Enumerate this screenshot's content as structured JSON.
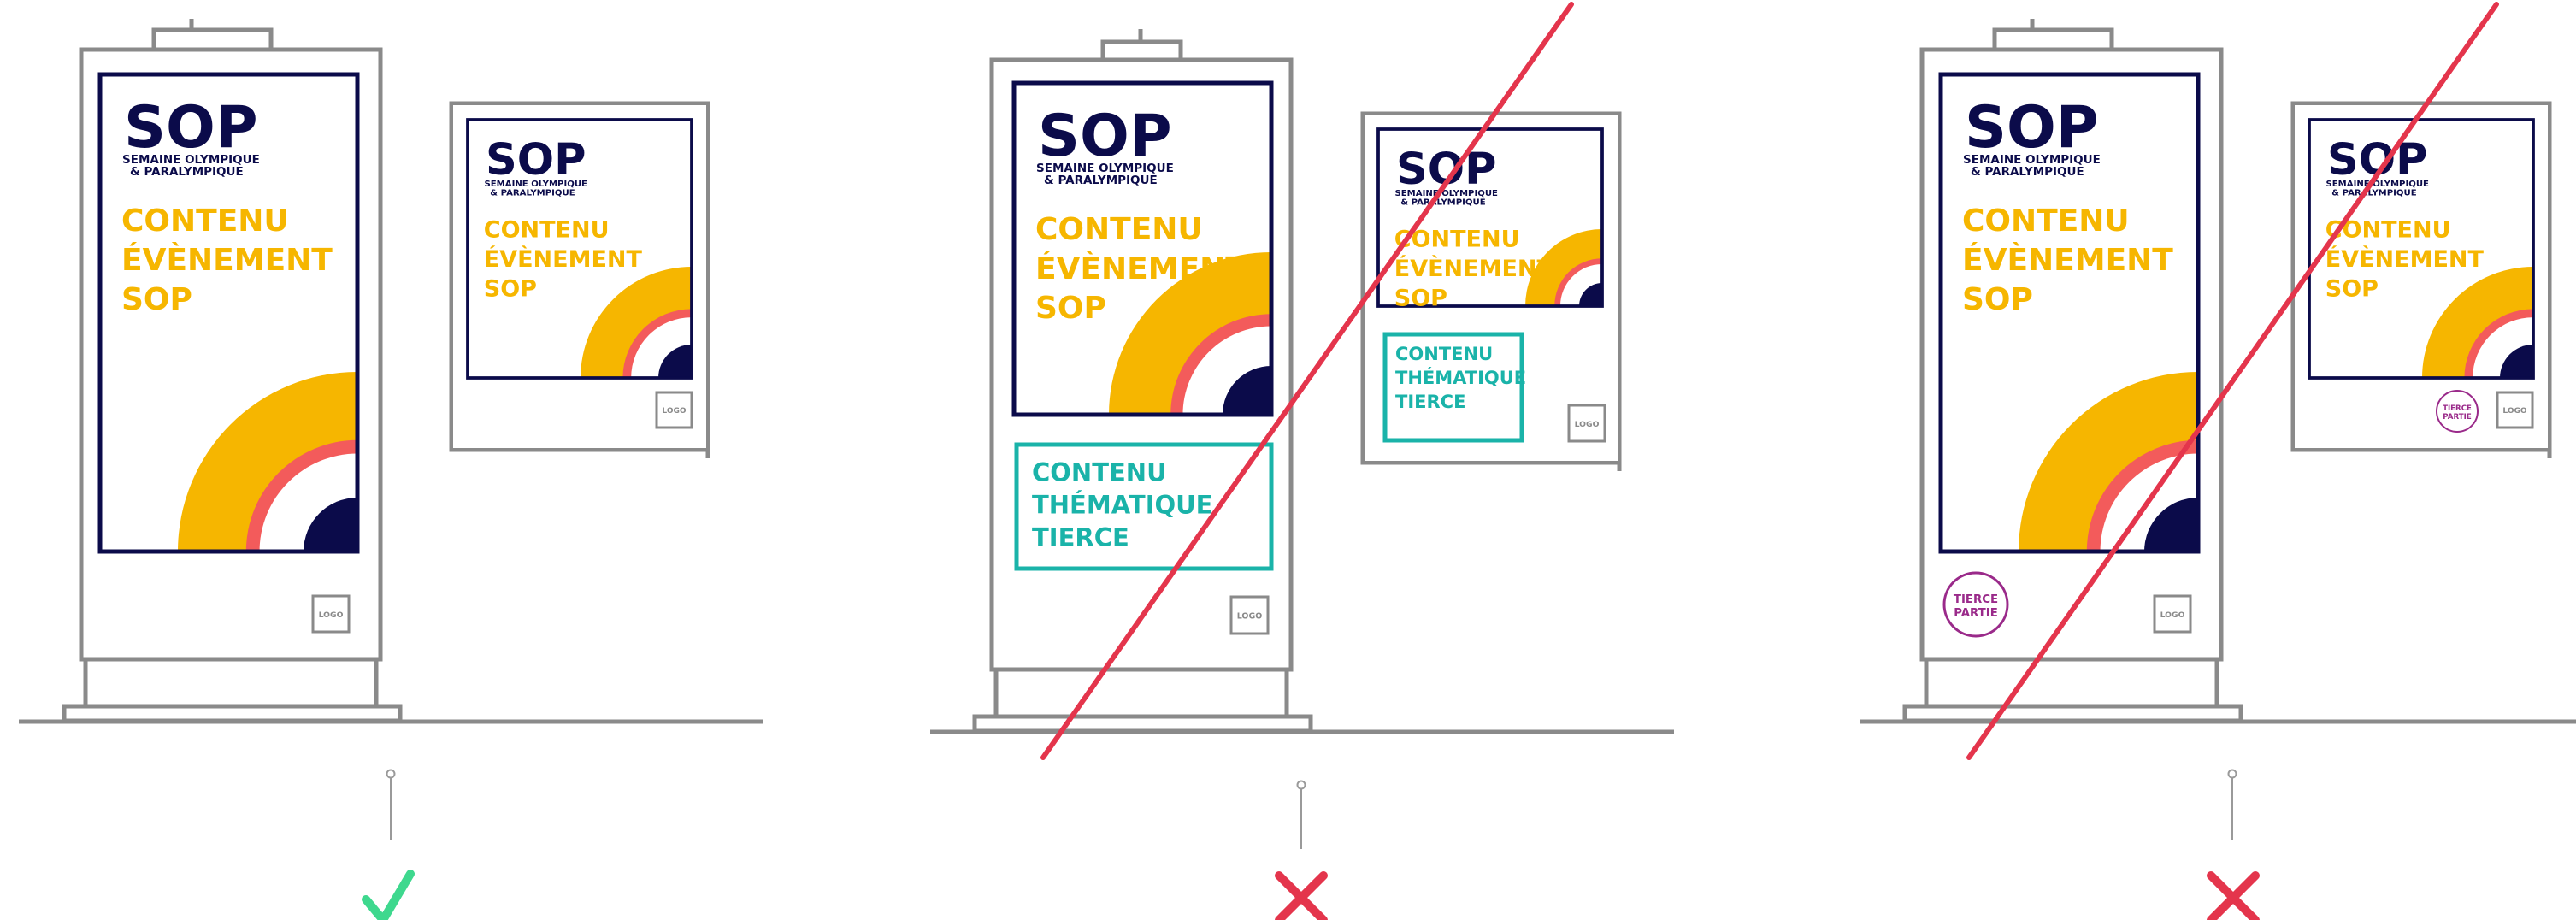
{
  "brand": {
    "logo_text": "SOP",
    "subtitle_line1": "SEMAINE OLYMPIQUE",
    "subtitle_line2": "& PARALYMPIQUE",
    "colors": {
      "navy": "#0b0b4a",
      "yellow": "#f6b600",
      "coral": "#f35b5b",
      "teal": "#1ab3a9",
      "purple": "#9a2a8a",
      "red": "#e4354c",
      "green": "#3ed88e",
      "frame": "#8a8a8a"
    }
  },
  "content": {
    "event_line1": "CONTENU",
    "event_line2": "ÉVÈNEMENT",
    "event_line3": "SOP",
    "thematic_line1": "CONTENU",
    "thematic_line2": "THÉMATIQUE",
    "thematic_line3": "TIERCE",
    "logo_label": "LOGO",
    "third_party_line1": "TIERCE",
    "third_party_line2": "PARTIE"
  },
  "panels": [
    {
      "id": "correct",
      "verdict": "check",
      "verdict_icon": "check-icon"
    },
    {
      "id": "incorrect-thematic",
      "verdict": "cross",
      "verdict_icon": "cross-icon"
    },
    {
      "id": "incorrect-third-party",
      "verdict": "cross",
      "verdict_icon": "cross-icon"
    }
  ]
}
